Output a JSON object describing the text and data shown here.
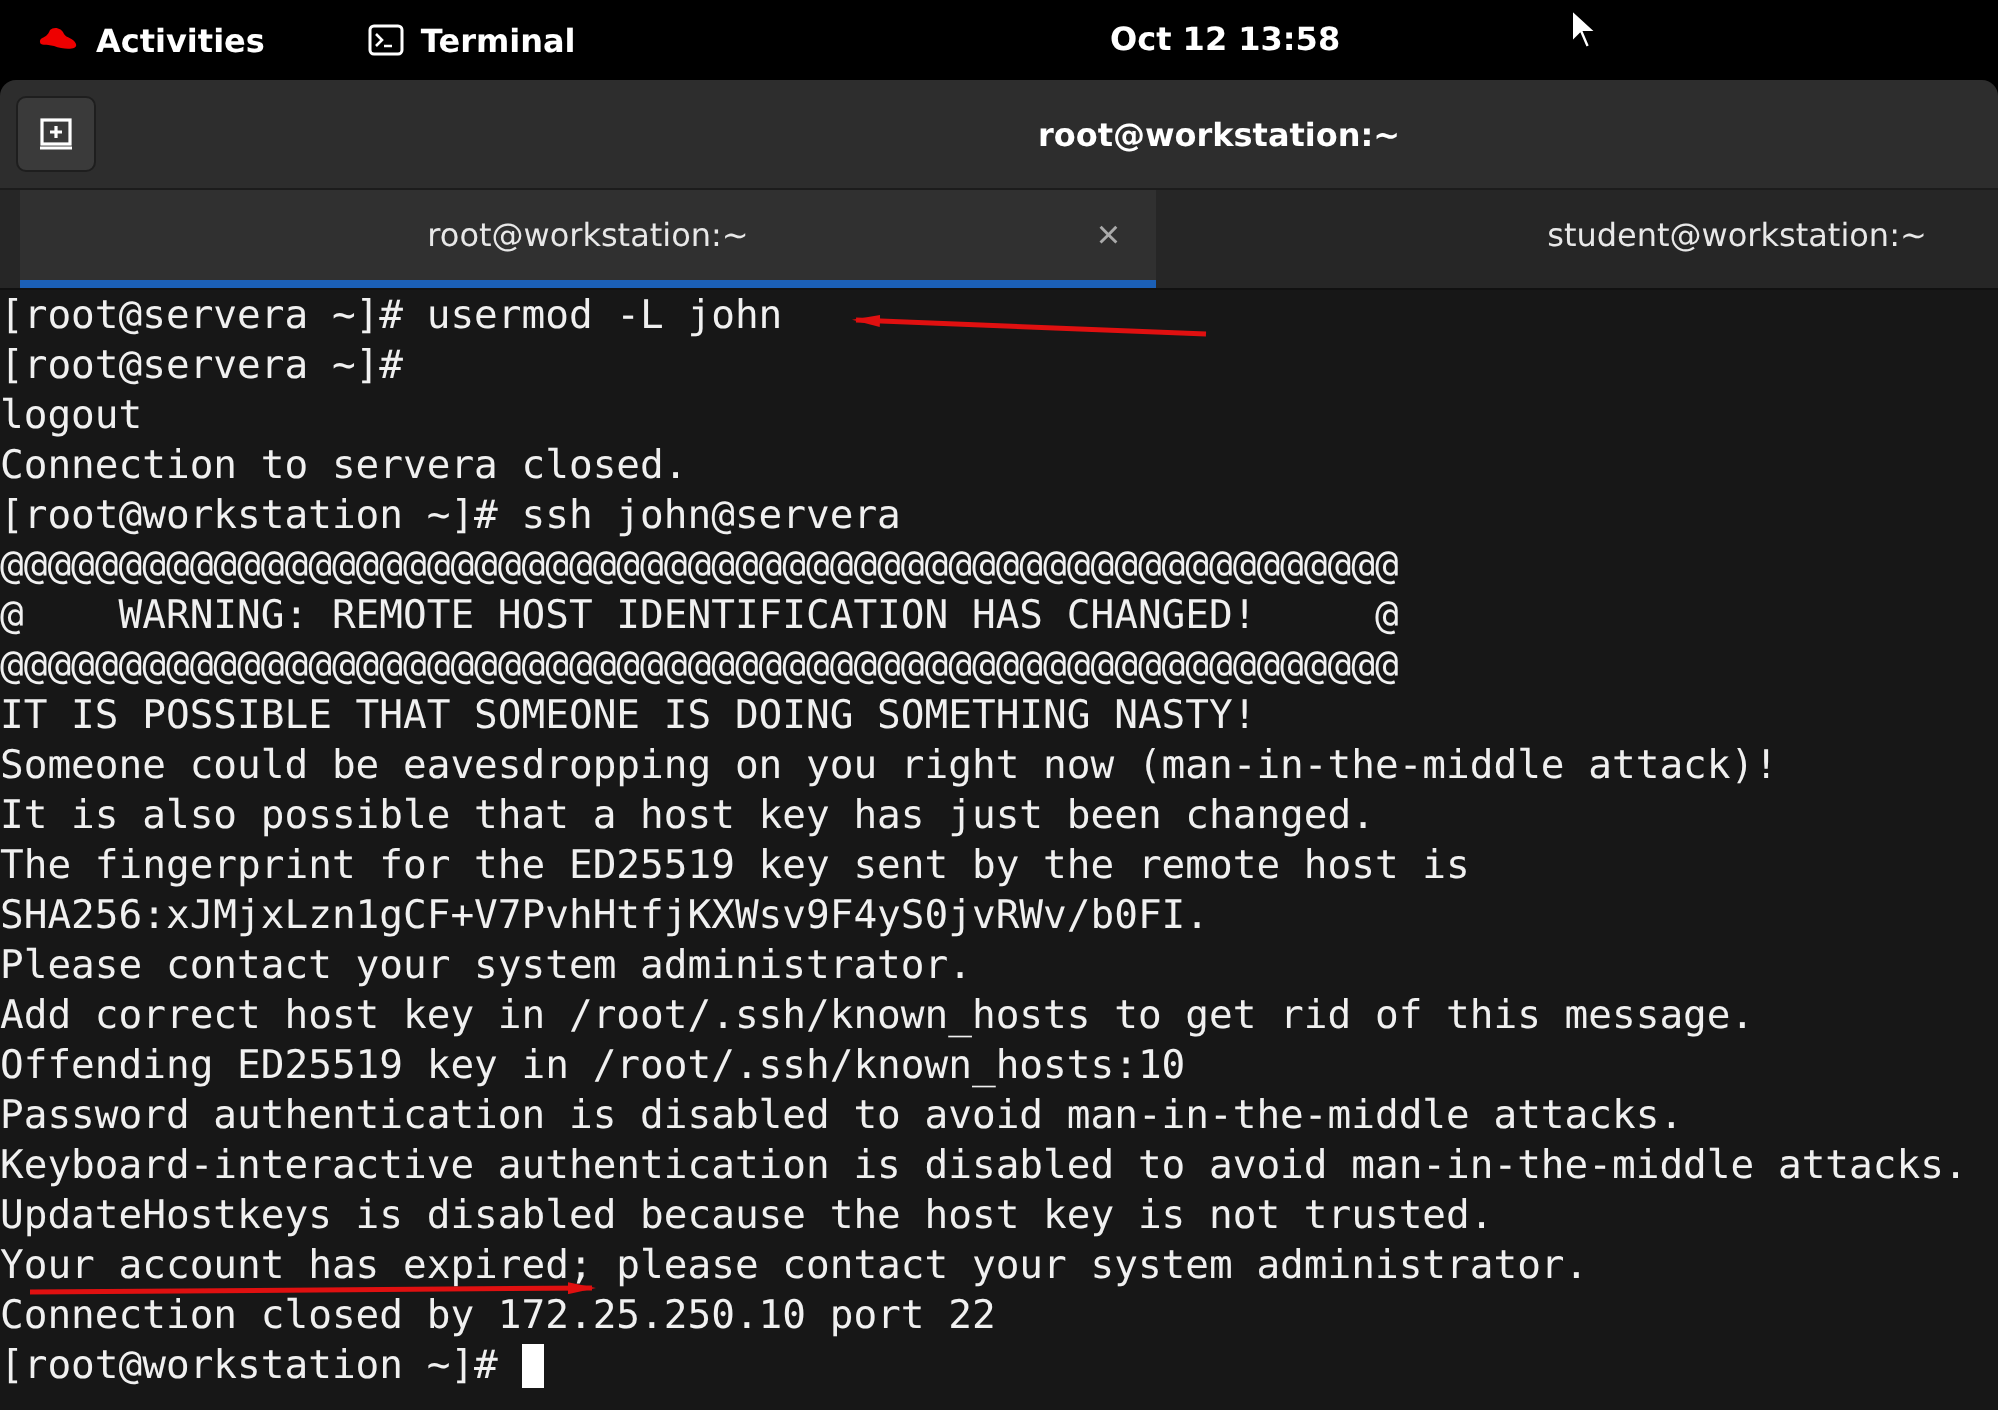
{
  "top_bar": {
    "activities": "Activities",
    "app": "Terminal",
    "clock": "Oct 12  13:58"
  },
  "window": {
    "title": "root@workstation:~"
  },
  "tabs": [
    {
      "label": "root@workstation:~",
      "selected": true,
      "close": "×"
    },
    {
      "label": "student@workstation:~",
      "selected": false
    }
  ],
  "terminal": {
    "cursor_visible": true,
    "lines": [
      "[root@servera ~]# usermod -L john",
      "[root@servera ~]#",
      "logout",
      "Connection to servera closed.",
      "[root@workstation ~]# ssh john@servera",
      "@@@@@@@@@@@@@@@@@@@@@@@@@@@@@@@@@@@@@@@@@@@@@@@@@@@@@@@@@@@",
      "@    WARNING: REMOTE HOST IDENTIFICATION HAS CHANGED!     @",
      "@@@@@@@@@@@@@@@@@@@@@@@@@@@@@@@@@@@@@@@@@@@@@@@@@@@@@@@@@@@",
      "IT IS POSSIBLE THAT SOMEONE IS DOING SOMETHING NASTY!",
      "Someone could be eavesdropping on you right now (man-in-the-middle attack)!",
      "It is also possible that a host key has just been changed.",
      "The fingerprint for the ED25519 key sent by the remote host is",
      "SHA256:xJMjxLzn1gCF+V7PvhHtfjKXWsv9F4yS0jvRWv/b0FI.",
      "Please contact your system administrator.",
      "Add correct host key in /root/.ssh/known_hosts to get rid of this message.",
      "Offending ED25519 key in /root/.ssh/known_hosts:10",
      "Password authentication is disabled to avoid man-in-the-middle attacks.",
      "Keyboard-interactive authentication is disabled to avoid man-in-the-middle attacks.",
      "UpdateHostkeys is disabled because the host key is not trusted.",
      "Your account has expired; please contact your system administrator.",
      "Connection closed by 172.25.250.10 port 22",
      "[root@workstation ~]# "
    ]
  }
}
